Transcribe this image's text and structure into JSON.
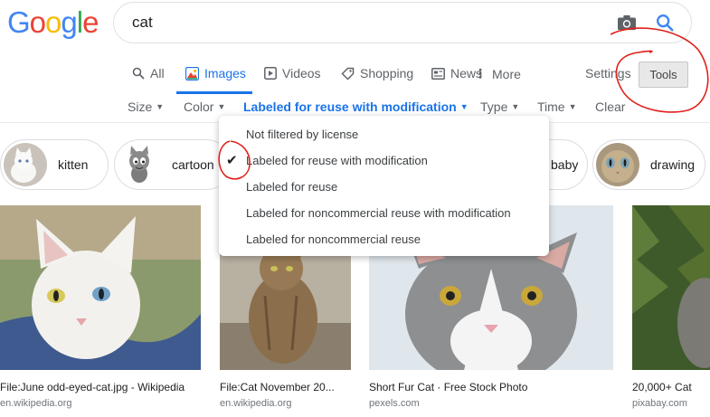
{
  "logo": {
    "letters": [
      "G",
      "o",
      "o",
      "g",
      "l",
      "e"
    ],
    "colors": [
      "#4285F4",
      "#EA4335",
      "#FBBC05",
      "#4285F4",
      "#34A853",
      "#EA4335"
    ]
  },
  "search": {
    "query": "cat"
  },
  "tabs": {
    "all": "All",
    "images": "Images",
    "videos": "Videos",
    "shopping": "Shopping",
    "news": "News",
    "more": "More",
    "settings": "Settings",
    "tools": "Tools"
  },
  "filters": {
    "size": "Size",
    "color": "Color",
    "license": "Labeled for reuse with modification",
    "type": "Type",
    "time": "Time",
    "clear": "Clear"
  },
  "license_menu": {
    "items": [
      "Not filtered by license",
      "Labeled for reuse with modification",
      "Labeled for reuse",
      "Labeled for noncommercial reuse with modification",
      "Labeled for noncommercial reuse"
    ],
    "selected_index": 1
  },
  "chips": {
    "kitten": "kitten",
    "cartoon": "cartoon",
    "baby": "baby",
    "drawing": "drawing"
  },
  "results": [
    {
      "title": "File:June odd-eyed-cat.jpg - Wikipedia",
      "source": "en.wikipedia.org"
    },
    {
      "title": "File:Cat November 20...",
      "source": "en.wikipedia.org"
    },
    {
      "title": "Short Fur Cat · Free Stock Photo",
      "source": "pexels.com"
    },
    {
      "title": "20,000+ Cat",
      "source": "pixabay.com"
    }
  ],
  "accent_color": "#1a73e8",
  "annotation_color": "#e0201b"
}
